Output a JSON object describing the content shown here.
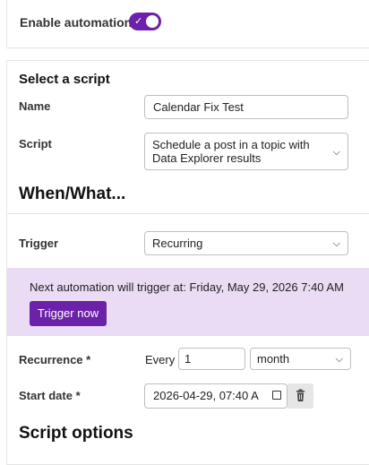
{
  "enable": {
    "label": "Enable automation",
    "toggle_on": true,
    "toggle_check": "✓"
  },
  "select_script": {
    "heading": "Select a script",
    "name_label": "Name",
    "name_value": "Calendar Fix Test",
    "script_label": "Script",
    "script_value_line1": "Schedule a post in a topic with",
    "script_value_line2": "Data Explorer results"
  },
  "when_what": {
    "heading": "When/What...",
    "trigger_label": "Trigger",
    "trigger_value": "Recurring",
    "banner_text": "Next automation will trigger at: Friday, May 29, 2026 7:40 AM",
    "trigger_now_label": "Trigger now",
    "recurrence_label": "Recurrence *",
    "every_label": "Every",
    "every_value": "1",
    "unit_value": "month",
    "start_date_label": "Start date *",
    "start_date_value": "2026-04-29, 07:40 A"
  },
  "script_options": {
    "heading": "Script options"
  },
  "colors": {
    "accent": "#6b21a8",
    "banner_bg": "#e9dcf4"
  }
}
